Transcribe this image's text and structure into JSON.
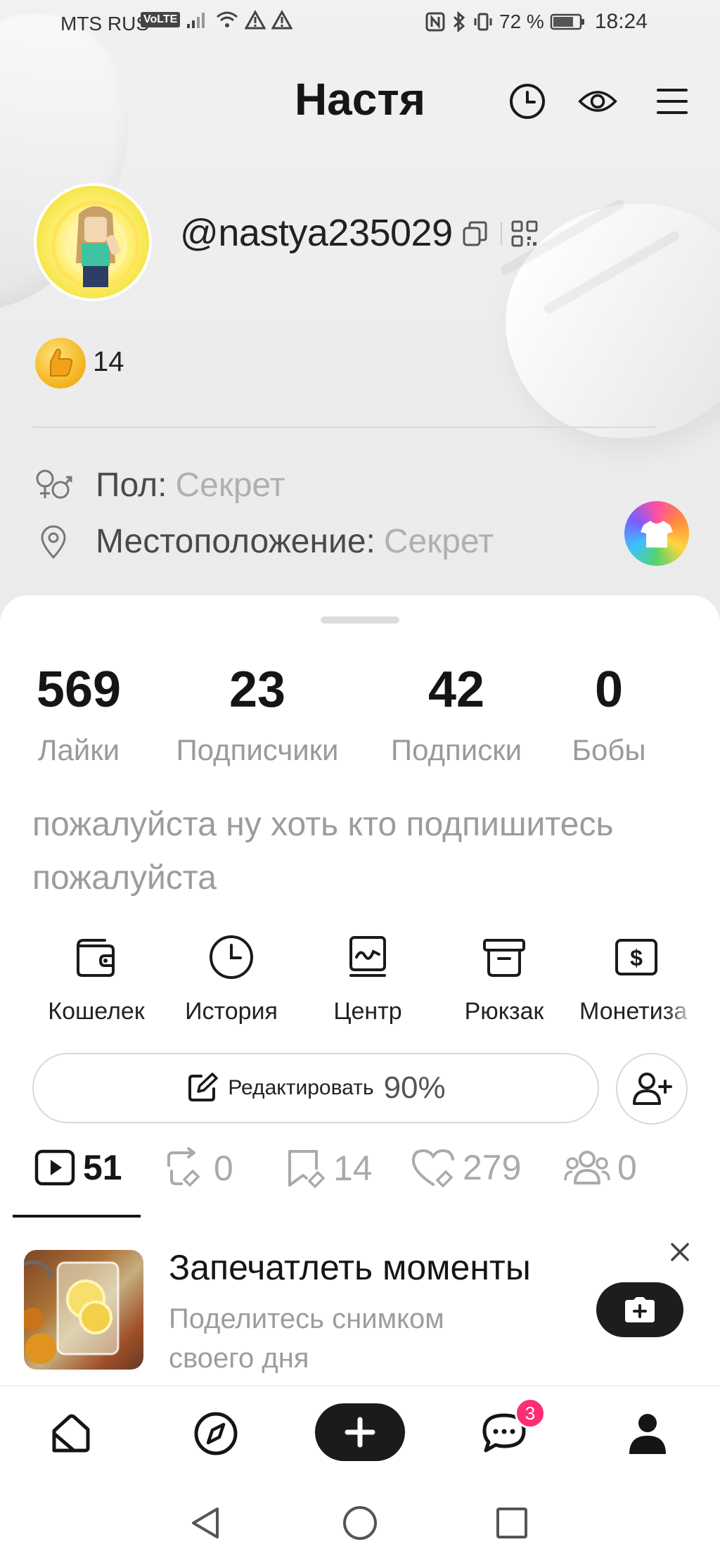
{
  "status_bar": {
    "carrier": "MTS RUS",
    "volte": "VoLTE",
    "battery": "72 %",
    "time": "18:24"
  },
  "header": {
    "title": "Настя",
    "icons": [
      "clock-icon",
      "eye-icon",
      "menu-icon"
    ]
  },
  "profile": {
    "username": "@nastya235029",
    "likes_badge_count": "14",
    "gender_label": "Пол:",
    "gender_value": "Секрет",
    "location_label": "Местоположение:",
    "location_value": "Секрет"
  },
  "stats": [
    {
      "value": "569",
      "label": "Лайки"
    },
    {
      "value": "23",
      "label": "Подписчики"
    },
    {
      "value": "42",
      "label": "Подписки"
    },
    {
      "value": "0",
      "label": "Бобы"
    }
  ],
  "bio": "пожалуйста ну хоть кто подпишитесь пожалуйста",
  "tools": [
    {
      "label": "Кошелек",
      "icon": "wallet-icon"
    },
    {
      "label": "История",
      "icon": "history-clock-icon"
    },
    {
      "label": "Центр",
      "icon": "center-chart-icon"
    },
    {
      "label": "Рюкзак",
      "icon": "archive-box-icon"
    },
    {
      "label": "Монетиза",
      "icon": "dollar-icon"
    }
  ],
  "edit": {
    "label": "Редактировать",
    "percent": "90%"
  },
  "content_tabs": [
    {
      "count": "51",
      "icon": "video-play-icon"
    },
    {
      "count": "0",
      "icon": "repost-icon"
    },
    {
      "count": "14",
      "icon": "bookmark-icon"
    },
    {
      "count": "279",
      "icon": "liked-heart-icon"
    },
    {
      "count": "0",
      "icon": "group-icon"
    }
  ],
  "prompt_card": {
    "title": "Запечатлеть моменты",
    "subtitle": "Поделитесь снимком своего дня"
  },
  "bottom_nav": {
    "items": [
      "home-icon",
      "discover-compass-icon",
      "create-plus-icon",
      "messages-icon",
      "profile-icon"
    ],
    "messages_badge": "3"
  },
  "colors": {
    "accent_dark": "#1b1b1b",
    "badge_pink": "#ff2d74",
    "muted_text": "#9c9c9c"
  }
}
